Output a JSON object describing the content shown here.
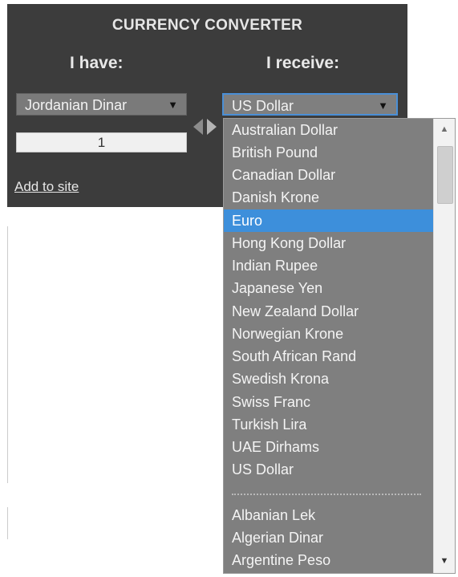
{
  "widget": {
    "title": "CURRENCY CONVERTER",
    "have_label": "I have:",
    "receive_label": "I receive:",
    "from_currency": "Jordanian Dinar",
    "to_currency": "US Dollar",
    "amount": "1",
    "add_link": "Add to site",
    "dropdown_arrow": "▼"
  },
  "dropdown": {
    "options": [
      "Australian Dollar",
      "British Pound",
      "Canadian Dollar",
      "Danish Krone",
      "Euro",
      "Hong Kong Dollar",
      "Indian Rupee",
      "Japanese Yen",
      "New Zealand Dollar",
      "Norwegian Krone",
      "South African Rand",
      "Swedish Krona",
      "Swiss Franc",
      "Turkish Lira",
      "UAE Dirhams",
      "US Dollar"
    ],
    "more_options": [
      "Albanian Lek",
      "Algerian Dinar",
      "Argentine Peso"
    ],
    "highlighted": "Euro"
  },
  "colors": {
    "panel": "#3c3c3c",
    "dropdown_bg": "#7f7f7f",
    "highlight": "#3d8fdb",
    "focus_border": "#4a8fd6"
  },
  "icons": {
    "swap": "swap-arrows-icon",
    "dropdown": "caret-down-icon",
    "scroll_up": "scroll-up-arrow-icon",
    "scroll_down": "scroll-down-arrow-icon"
  }
}
